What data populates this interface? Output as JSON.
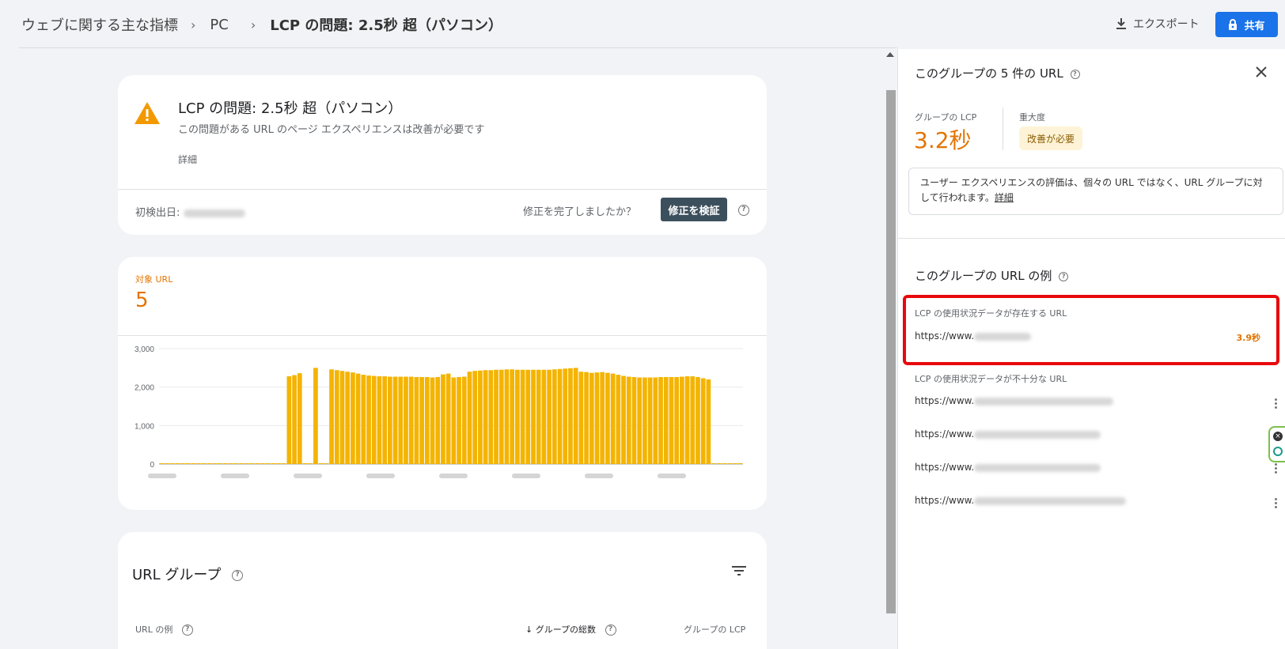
{
  "breadcrumb": {
    "root": "ウェブに関する主な指標",
    "device": "PC",
    "current": "LCP の問題: 2.5秒 超（パソコン）"
  },
  "toolbar": {
    "export_label": "エクスポート",
    "share_label": "共有"
  },
  "issue_card": {
    "title": "LCP の問題: 2.5秒 超（パソコン）",
    "subtitle": "この問題がある URL のページ エクスペリエンスは改善が必要です",
    "details_link": "詳細",
    "first_detected_label": "初検出日:",
    "fix_question": "修正を完了しましたか？",
    "validate_button": "修正を検証"
  },
  "chart_card": {
    "metric_label": "対象 URL",
    "metric_value": "5"
  },
  "chart_data": {
    "type": "bar",
    "yticks": [
      "3,000",
      "2,000",
      "1,000",
      "0"
    ],
    "ylim": [
      0,
      3000
    ],
    "color": "#f4b400",
    "values": [
      0,
      0,
      0,
      0,
      0,
      0,
      0,
      0,
      0,
      0,
      0,
      0,
      0,
      0,
      0,
      0,
      0,
      0,
      0,
      0,
      0,
      0,
      0,
      0,
      2280,
      2310,
      2360,
      0,
      0,
      2500,
      0,
      0,
      2460,
      2440,
      2420,
      2400,
      2380,
      2350,
      2320,
      2300,
      2290,
      2280,
      2280,
      2270,
      2270,
      2270,
      2270,
      2270,
      2260,
      2260,
      2260,
      2250,
      2260,
      2330,
      2350,
      2250,
      2260,
      2270,
      2400,
      2420,
      2430,
      2440,
      2440,
      2450,
      2450,
      2460,
      2460,
      2450,
      2450,
      2450,
      2450,
      2450,
      2450,
      2450,
      2460,
      2470,
      2480,
      2490,
      2500,
      2400,
      2390,
      2370,
      2380,
      2390,
      2370,
      2350,
      2320,
      2290,
      2270,
      2260,
      2250,
      2250,
      2250,
      2250,
      2260,
      2260,
      2260,
      2260,
      2270,
      2280,
      2280,
      2260,
      2230,
      2200,
      0,
      0,
      0,
      0,
      0,
      0
    ]
  },
  "url_group_card": {
    "title": "URL グループ",
    "col_example": "URL の例",
    "col_total": "グループの総数",
    "col_lcp": "グループの LCP"
  },
  "panel": {
    "title": "このグループの 5 件の URL",
    "group_lcp_label": "グループの LCP",
    "group_lcp_value": "3.2秒",
    "severity_label": "重大度",
    "severity_badge": "改善が必要",
    "info_text": "ユーザー エクスペリエンスの評価は、個々の URL ではなく、URL グループに対して行われます。",
    "info_link": "詳細",
    "examples_title": "このグループの URL の例",
    "with_data_label": "LCP の使用状況データが存在する URL",
    "with_data_urls": [
      {
        "url": "https://www.",
        "value": "3.9秒"
      }
    ],
    "insufficient_label": "LCP の使用状況データが不十分な URL",
    "insufficient_urls": [
      "https://www.",
      "https://www.",
      "https://www.",
      "https://www."
    ]
  },
  "colors": {
    "accent": "#1a73e8",
    "warning": "#e37400",
    "bar": "#f4b400",
    "highlight": "#e8080c"
  }
}
